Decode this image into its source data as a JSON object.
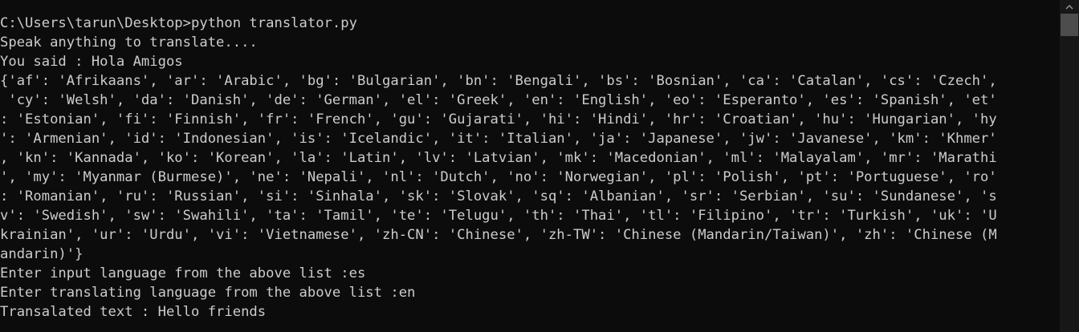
{
  "console": {
    "lines": [
      "C:\\Users\\tarun\\Desktop>python translator.py",
      "Speak anything to translate....",
      "You said : Hola Amigos",
      "{'af': 'Afrikaans', 'ar': 'Arabic', 'bg': 'Bulgarian', 'bn': 'Bengali', 'bs': 'Bosnian', 'ca': 'Catalan', 'cs': 'Czech',",
      " 'cy': 'Welsh', 'da': 'Danish', 'de': 'German', 'el': 'Greek', 'en': 'English', 'eo': 'Esperanto', 'es': 'Spanish', 'et'",
      ": 'Estonian', 'fi': 'Finnish', 'fr': 'French', 'gu': 'Gujarati', 'hi': 'Hindi', 'hr': 'Croatian', 'hu': 'Hungarian', 'hy",
      "': 'Armenian', 'id': 'Indonesian', 'is': 'Icelandic', 'it': 'Italian', 'ja': 'Japanese', 'jw': 'Javanese', 'km': 'Khmer'",
      ", 'kn': 'Kannada', 'ko': 'Korean', 'la': 'Latin', 'lv': 'Latvian', 'mk': 'Macedonian', 'ml': 'Malayalam', 'mr': 'Marathi",
      "', 'my': 'Myanmar (Burmese)', 'ne': 'Nepali', 'nl': 'Dutch', 'no': 'Norwegian', 'pl': 'Polish', 'pt': 'Portuguese', 'ro'",
      ": 'Romanian', 'ru': 'Russian', 'si': 'Sinhala', 'sk': 'Slovak', 'sq': 'Albanian', 'sr': 'Serbian', 'su': 'Sundanese', 's",
      "v': 'Swedish', 'sw': 'Swahili', 'ta': 'Tamil', 'te': 'Telugu', 'th': 'Thai', 'tl': 'Filipino', 'tr': 'Turkish', 'uk': 'U",
      "krainian', 'ur': 'Urdu', 'vi': 'Vietnamese', 'zh-CN': 'Chinese', 'zh-TW': 'Chinese (Mandarin/Taiwan)', 'zh': 'Chinese (M",
      "andarin)'}",
      "Enter input language from the above list :es",
      "Enter translating language from the above list :en",
      "Transalated text : Hello friends"
    ]
  },
  "colors": {
    "background": "#0c0c0c",
    "text": "#cccccc",
    "scrollbar_track": "#171717",
    "scrollbar_thumb": "#4d4d4d"
  }
}
